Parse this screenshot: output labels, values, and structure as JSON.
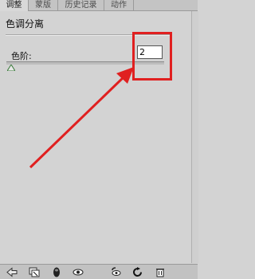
{
  "tabs": [
    {
      "label": "调整",
      "active": true
    },
    {
      "label": "蒙版",
      "active": false
    },
    {
      "label": "历史记录",
      "active": false
    },
    {
      "label": "动作",
      "active": false
    }
  ],
  "panel": {
    "title": "色调分离",
    "levels_label": "色阶:",
    "levels_value": "2"
  },
  "bottom_icons": [
    "back-arrow-icon",
    "clip-to-layer-icon",
    "mask-visibility-icon",
    "eye-icon",
    "previous-state-icon",
    "reset-icon",
    "trash-icon"
  ],
  "colors": {
    "panel_bg": "#d3d3d3",
    "highlight": "#e02020"
  }
}
